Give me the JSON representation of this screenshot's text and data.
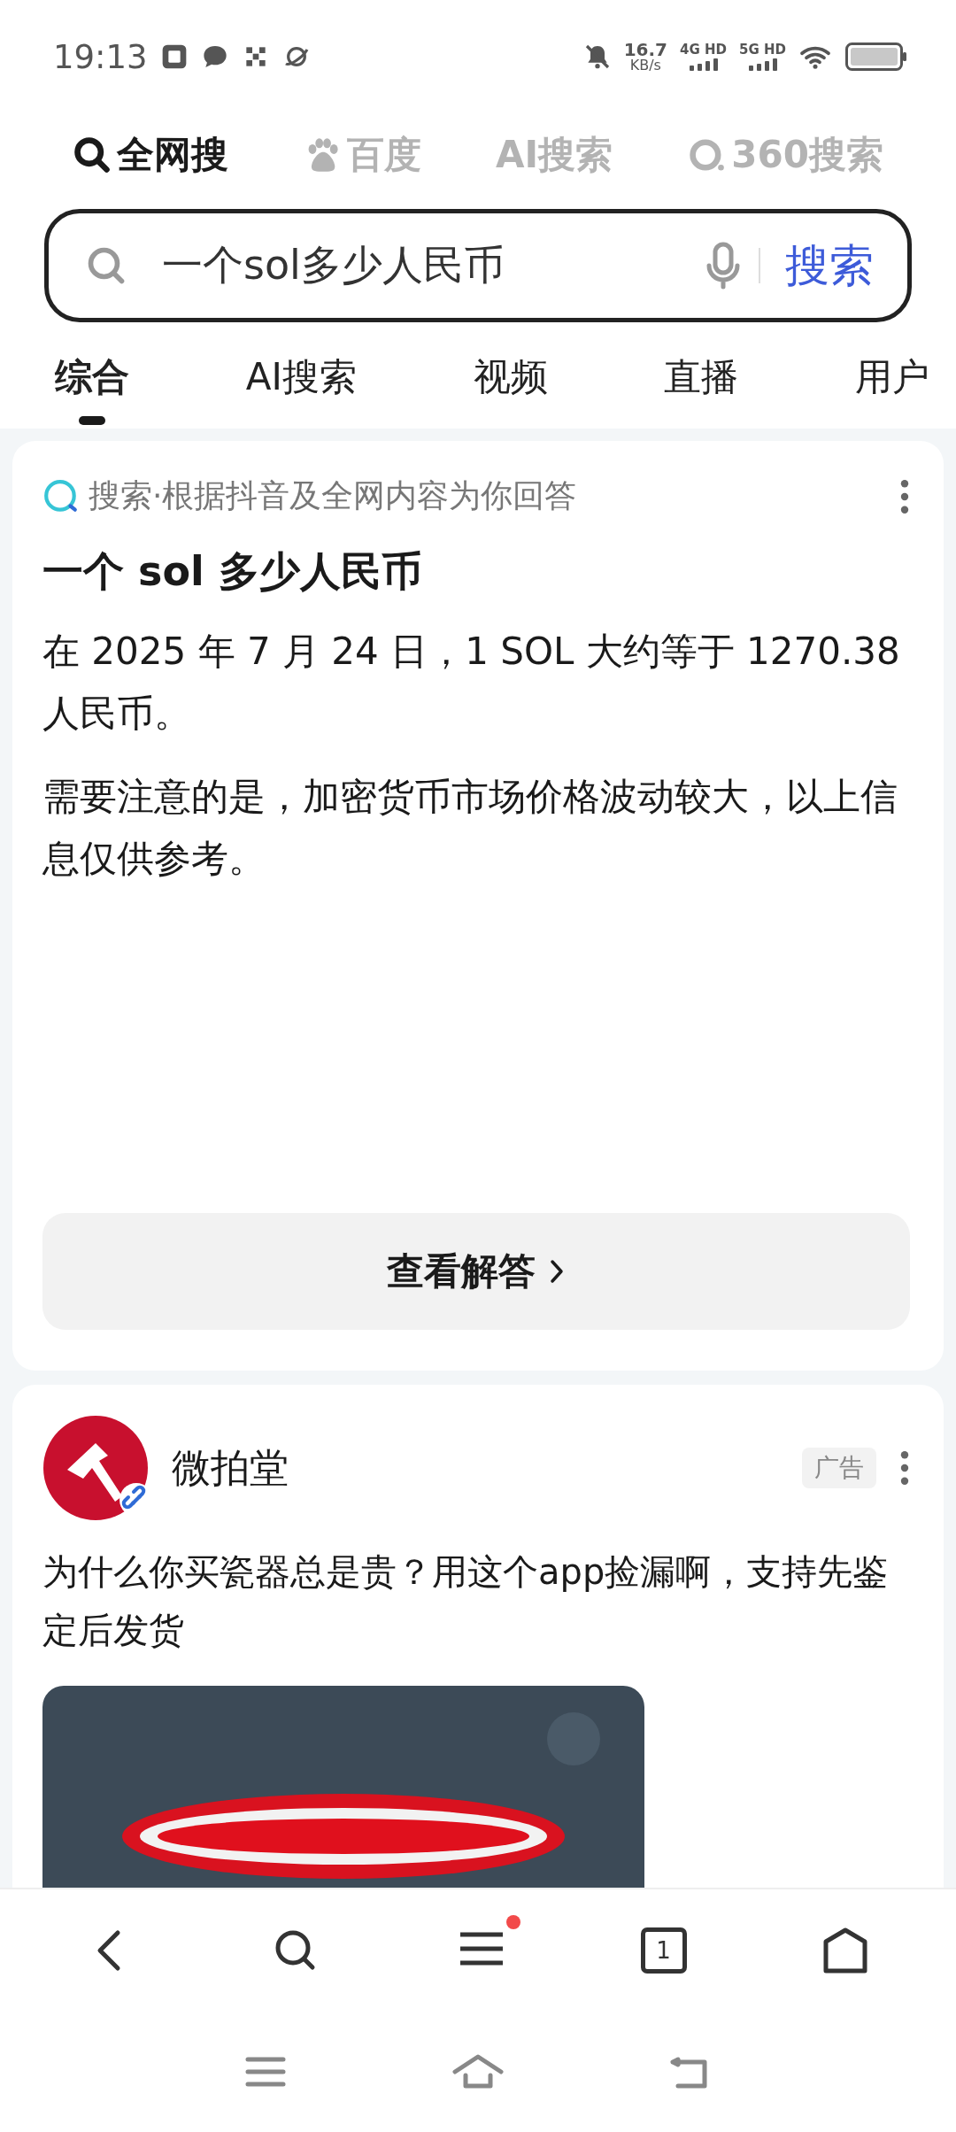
{
  "status_bar": {
    "time": "19:13",
    "net_speed": "16.7",
    "net_speed_unit": "KB/s",
    "sim_1": "4G HD",
    "sim_2": "5G HD"
  },
  "engines": [
    {
      "label": "全网搜",
      "kind": "all",
      "selected": true
    },
    {
      "label": "百度",
      "kind": "paw",
      "selected": false
    },
    {
      "label": "AI搜索",
      "kind": "plain",
      "selected": false
    },
    {
      "label": "360搜索",
      "kind": "ring",
      "selected": false
    }
  ],
  "search": {
    "value": "一个sol多少人民币",
    "button": "搜索"
  },
  "result_tabs": [
    {
      "label": "综合",
      "selected": true
    },
    {
      "label": "AI搜索",
      "selected": false
    },
    {
      "label": "视频",
      "selected": false
    },
    {
      "label": "直播",
      "selected": false
    },
    {
      "label": "用户",
      "selected": false
    }
  ],
  "ai_card": {
    "source": "搜索·根据抖音及全网内容为你回答",
    "title": "一个 sol 多少人民币",
    "paragraphs": [
      "在 2025 年 7 月 24 日，1 SOL 大约等于 1270.38 人民币。",
      "需要注意的是，加密货币市场价格波动较大，以上信息仅供参考。"
    ],
    "button": "查看解答"
  },
  "ad_card": {
    "advertiser": "微拍堂",
    "ad_label": "广告",
    "text": "为什么你买瓷器总是贵？用这个app捡漏啊，支持先鉴定后发货"
  },
  "bottom_nav": {
    "tab_count": "1",
    "menu_badge": true
  }
}
